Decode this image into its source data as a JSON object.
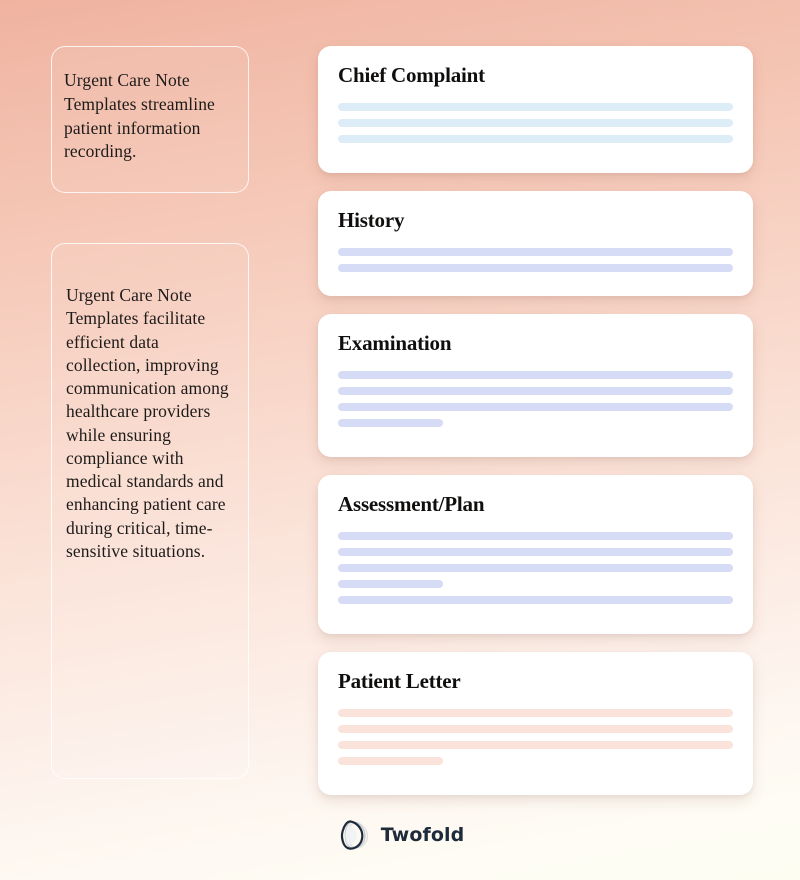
{
  "background": {
    "gradient_from": "#f0b3a0",
    "gradient_to": "#fdfdf2"
  },
  "left_column": {
    "cards": [
      {
        "name": "intro-quote-card",
        "text": "Urgent Care Note Templates streamline patient information recording."
      },
      {
        "name": "detail-quote-card",
        "text": "Urgent Care Note Templates facilitate efficient data collection, improving communication among healthcare providers while ensuring compliance with medical standards and enhancing patient care during critical, time-sensitive situations."
      }
    ]
  },
  "note_cards": [
    {
      "id": "chief-complaint",
      "title": "Chief Complaint",
      "accent": "#dcedf8",
      "accent_name": "light-blue",
      "lines": [
        {
          "width_percent": 100
        },
        {
          "width_percent": 100
        },
        {
          "width_percent": 100
        }
      ]
    },
    {
      "id": "history",
      "title": "History",
      "accent": "#d6dbf6",
      "accent_name": "periwinkle",
      "lines": [
        {
          "width_percent": 100
        },
        {
          "width_percent": 100
        }
      ]
    },
    {
      "id": "examination",
      "title": "Examination",
      "accent": "#d6dbf6",
      "accent_name": "periwinkle",
      "lines": [
        {
          "width_percent": 100
        },
        {
          "width_percent": 100
        },
        {
          "width_percent": 100
        },
        {
          "width_percent": 26.5
        }
      ]
    },
    {
      "id": "assessment-plan",
      "title": "Assessment/Plan",
      "accent": "#d6dbf6",
      "accent_name": "periwinkle",
      "lines": [
        {
          "width_percent": 100
        },
        {
          "width_percent": 100
        },
        {
          "width_percent": 100
        },
        {
          "width_percent": 26.5
        },
        {
          "width_percent": 100
        }
      ]
    },
    {
      "id": "patient-letter",
      "title": "Patient Letter",
      "accent": "#fae3da",
      "accent_name": "pink",
      "lines": [
        {
          "width_percent": 100
        },
        {
          "width_percent": 100
        },
        {
          "width_percent": 100
        },
        {
          "width_percent": 26.5
        }
      ]
    }
  ],
  "footer": {
    "logo_icon": "twofold-teardrop-logo-icon",
    "brand_name": "Twofold",
    "brand_color": "#1d2b3a"
  }
}
